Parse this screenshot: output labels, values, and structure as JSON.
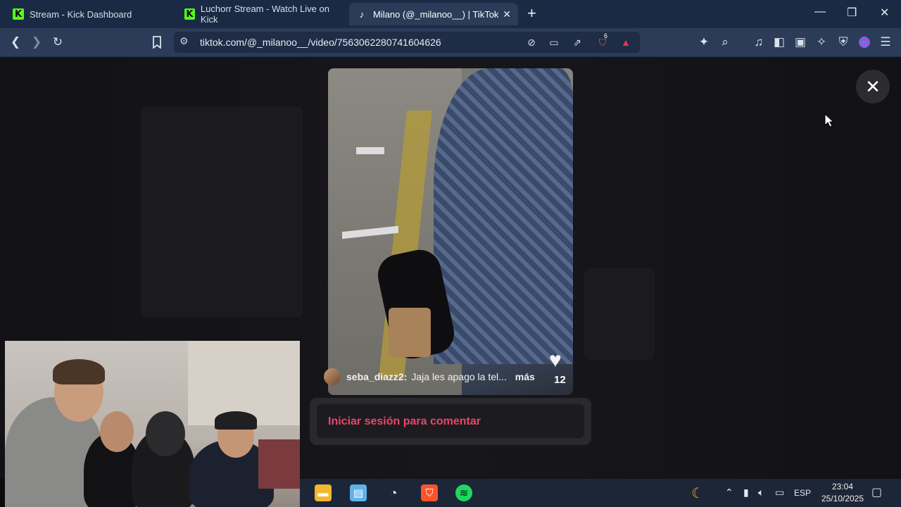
{
  "tabs": [
    {
      "title": "Stream - Kick Dashboard",
      "favicon": "kick-icon"
    },
    {
      "title": "Luchorr Stream - Watch Live on Kick",
      "favicon": "kick-icon"
    },
    {
      "title": "Milano (@_milanoo__) | TikTok",
      "favicon": "tiktok-icon",
      "active": true
    }
  ],
  "address_bar": {
    "url": "tiktok.com/@_milanoo__/video/7563062280741604626"
  },
  "brave_badge_count": "6",
  "video": {
    "comment_user": "seba_diazz2:",
    "comment_text": "Jaja les apago la tel...",
    "more_label": "más",
    "like_count": "12"
  },
  "login_prompt": "Iniciar sesión para comentar",
  "taskbar": {
    "language": "ESP",
    "time": "23:04",
    "date": "25/10/2025"
  },
  "colors": {
    "tab_strip": "#1b2a44",
    "toolbar": "#2b3b58",
    "login_accent": "#e8466a",
    "kick_green": "#53fc18"
  }
}
